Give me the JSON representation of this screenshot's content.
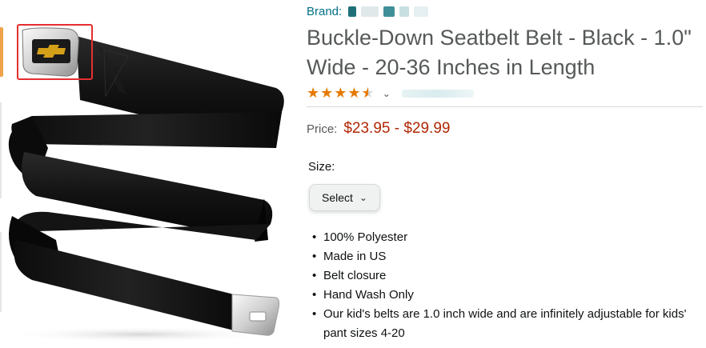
{
  "brand": {
    "label": "Brand:",
    "name_redacted_colors": [
      "#1f6f78",
      "#e0e8ea",
      "#7fb5bb",
      "#c8dfe2"
    ]
  },
  "product": {
    "title": "Buckle-Down Seatbelt Belt - Black - 1.0\" Wide - 20-36 Inches in Length",
    "rating": {
      "stars": 4.5,
      "chevron": "⌄"
    },
    "price_label": "Price:",
    "price_value": "$23.95 - $29.99",
    "size_label": "Size:",
    "size_select": {
      "value": "Select",
      "chevron": "⌄"
    },
    "bullets": [
      "100% Polyester",
      "Made in US",
      "Belt closure",
      "Hand Wash Only",
      "Our kid's belts are 1.0 inch wide and are infinitely adjustable for kids' pant sizes 4-20"
    ]
  },
  "image": {
    "highlight_color": "#e52f2f",
    "belt_color": "#141414",
    "buckle_emblem_color": "#d4a017"
  },
  "colors": {
    "link": "#007185",
    "price": "#b12704",
    "star": "#e67a00",
    "muted": "#565959"
  }
}
